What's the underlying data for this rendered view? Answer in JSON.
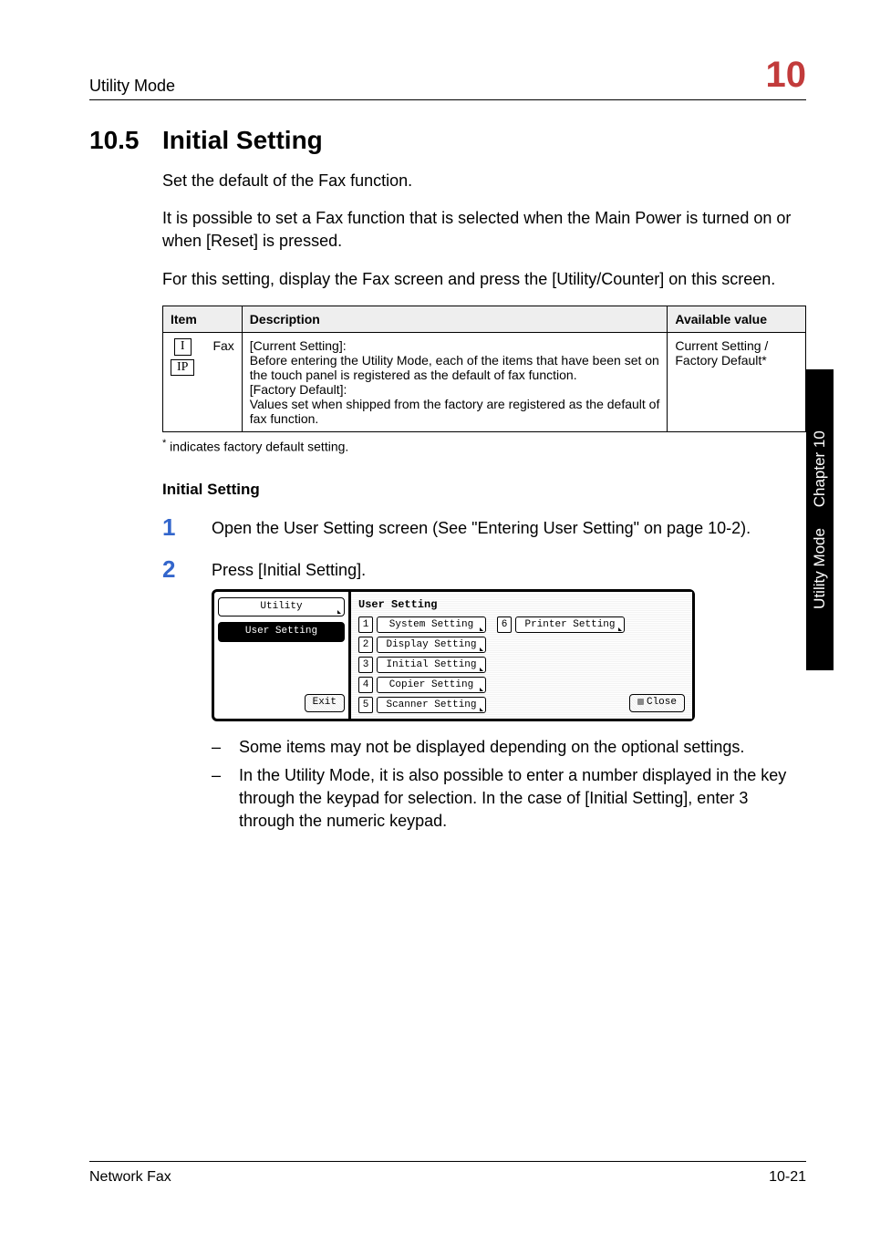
{
  "header": {
    "left": "Utility Mode",
    "right": "10"
  },
  "section": {
    "number": "10.5",
    "title": "Initial Setting"
  },
  "intro": {
    "p1": "Set the default of the Fax function.",
    "p2": "It is possible to set a Fax function that is selected when the Main Power is turned on or when [Reset] is pressed.",
    "p3": "For this setting, display the Fax screen and press the [Utility/Counter] on this screen."
  },
  "table": {
    "headers": {
      "item": "Item",
      "desc": "Description",
      "avail": "Available value"
    },
    "row": {
      "icons": {
        "top": "I",
        "bottom": "IP"
      },
      "name": "Fax",
      "desc": "[Current Setting]:\nBefore entering the Utility Mode, each of the items that have been set on the touch panel is registered as the default of fax function.\n[Factory Default]:\nValues set when shipped from the factory are registered as the default of fax function.",
      "avail": "Current Setting / Factory Default*"
    }
  },
  "footnote": "indicates factory default setting.",
  "subhead": "Initial Setting",
  "steps": {
    "s1": {
      "num": "1",
      "text": "Open the User Setting screen (See \"Entering User Setting\" on page 10-2)."
    },
    "s2": {
      "num": "2",
      "text": "Press [Initial Setting]."
    }
  },
  "ui": {
    "left": {
      "utility": "Utility",
      "user_setting": "User Setting",
      "exit": "Exit"
    },
    "title": "User Setting",
    "items_left": [
      {
        "n": "1",
        "label": "System Setting"
      },
      {
        "n": "2",
        "label": "Display Setting"
      },
      {
        "n": "3",
        "label": "Initial Setting"
      },
      {
        "n": "4",
        "label": "Copier Setting"
      },
      {
        "n": "5",
        "label": "Scanner Setting"
      }
    ],
    "items_right": [
      {
        "n": "6",
        "label": "Printer Setting"
      }
    ],
    "close": "Close"
  },
  "notes": {
    "n1": "Some items may not be displayed depending on the optional settings.",
    "n2": "In the Utility Mode, it is also possible to enter a number displayed in the key through the keypad for selection. In the case of [Initial Setting], enter 3 through the numeric keypad."
  },
  "side_tab": {
    "left": "Utility Mode",
    "right": "Chapter 10"
  },
  "footer": {
    "left": "Network Fax",
    "right": "10-21"
  }
}
